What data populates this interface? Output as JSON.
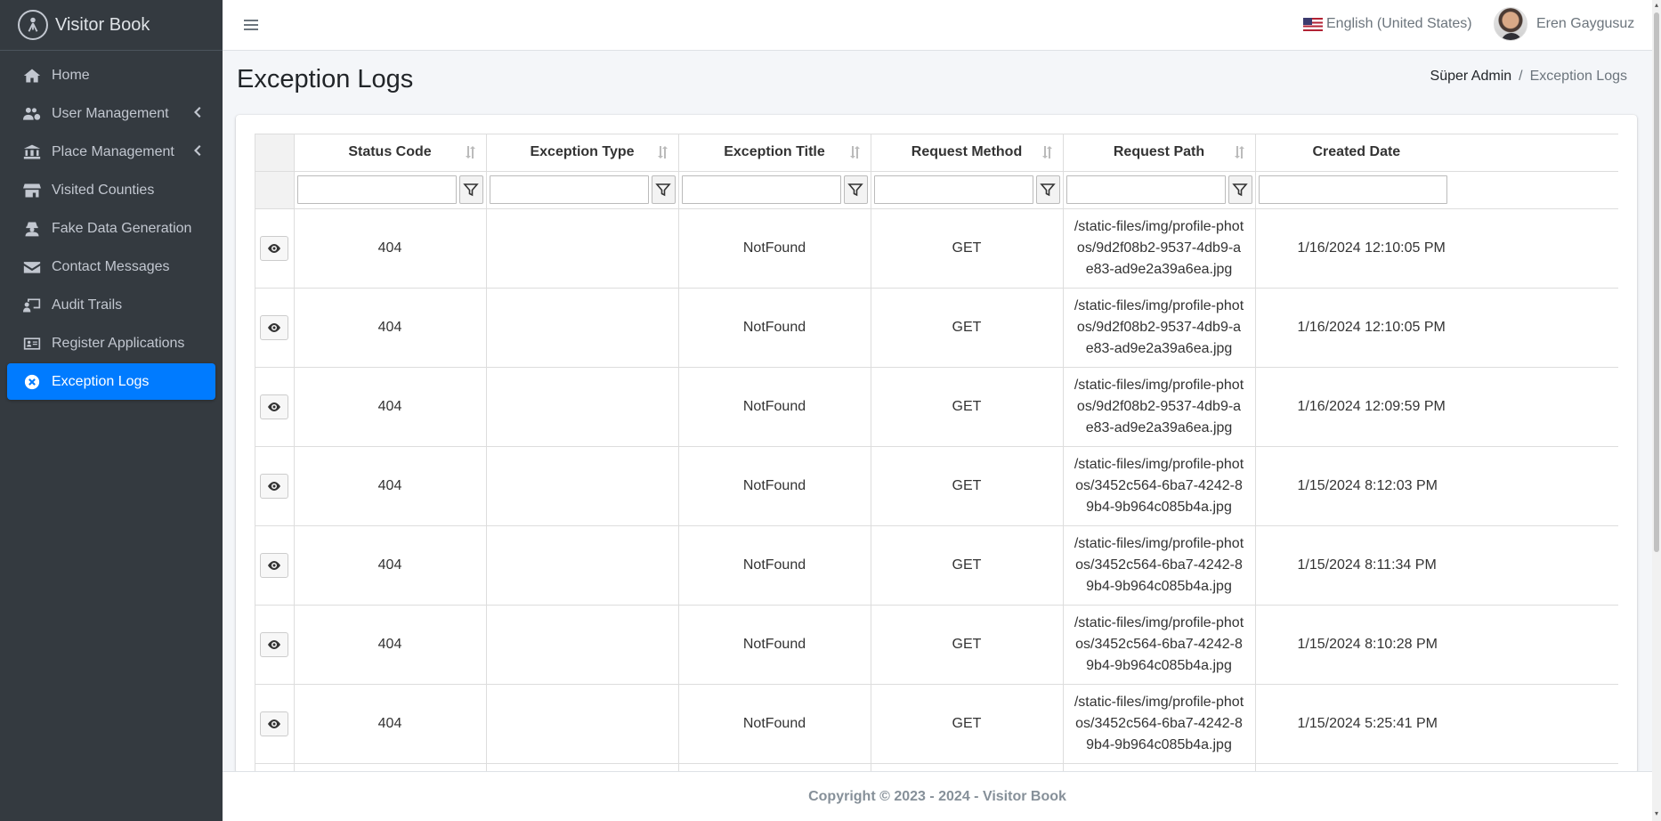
{
  "brand": {
    "name": "Visitor Book"
  },
  "sidebar": {
    "items": [
      {
        "label": "Home",
        "icon": "home-icon"
      },
      {
        "label": "User Management",
        "icon": "users-cog-icon",
        "has_children": true
      },
      {
        "label": "Place Management",
        "icon": "landmark-icon",
        "has_children": true
      },
      {
        "label": "Visited Counties",
        "icon": "store-icon"
      },
      {
        "label": "Fake Data Generation",
        "icon": "user-secret-icon"
      },
      {
        "label": "Contact Messages",
        "icon": "envelope-icon"
      },
      {
        "label": "Audit Trails",
        "icon": "chalkboard-user-icon"
      },
      {
        "label": "Register Applications",
        "icon": "id-card-icon"
      },
      {
        "label": "Exception Logs",
        "icon": "times-circle-icon",
        "active": true
      }
    ]
  },
  "topbar": {
    "language": "English (United States)",
    "user_name": "Eren Gaygusuz"
  },
  "page": {
    "title": "Exception Logs",
    "breadcrumb": [
      "Süper Admin",
      "Exception Logs"
    ]
  },
  "table": {
    "columns": [
      "Status Code",
      "Exception Type",
      "Exception Title",
      "Request Method",
      "Request Path",
      "Created Date"
    ],
    "rows": [
      {
        "status": "404",
        "type": "",
        "title": "NotFound",
        "method": "GET",
        "path": "/static-files/img/profile-photos/9d2f08b2-9537-4db9-ae83-ad9e2a39a6ea.jpg",
        "date": "1/16/2024 12:10:05 PM"
      },
      {
        "status": "404",
        "type": "",
        "title": "NotFound",
        "method": "GET",
        "path": "/static-files/img/profile-photos/9d2f08b2-9537-4db9-ae83-ad9e2a39a6ea.jpg",
        "date": "1/16/2024 12:10:05 PM"
      },
      {
        "status": "404",
        "type": "",
        "title": "NotFound",
        "method": "GET",
        "path": "/static-files/img/profile-photos/9d2f08b2-9537-4db9-ae83-ad9e2a39a6ea.jpg",
        "date": "1/16/2024 12:09:59 PM"
      },
      {
        "status": "404",
        "type": "",
        "title": "NotFound",
        "method": "GET",
        "path": "/static-files/img/profile-photos/3452c564-6ba7-4242-89b4-9b964c085b4a.jpg",
        "date": "1/15/2024 8:12:03 PM"
      },
      {
        "status": "404",
        "type": "",
        "title": "NotFound",
        "method": "GET",
        "path": "/static-files/img/profile-photos/3452c564-6ba7-4242-89b4-9b964c085b4a.jpg",
        "date": "1/15/2024 8:11:34 PM"
      },
      {
        "status": "404",
        "type": "",
        "title": "NotFound",
        "method": "GET",
        "path": "/static-files/img/profile-photos/3452c564-6ba7-4242-89b4-9b964c085b4a.jpg",
        "date": "1/15/2024 8:10:28 PM"
      },
      {
        "status": "404",
        "type": "",
        "title": "NotFound",
        "method": "GET",
        "path": "/static-files/img/profile-photos/3452c564-6ba7-4242-89b4-9b964c085b4a.jpg",
        "date": "1/15/2024 5:25:41 PM"
      }
    ]
  },
  "footer": {
    "text": "Copyright © 2023 - 2024 - Visitor Book"
  },
  "colors": {
    "sidebar_bg": "#343a40",
    "active": "#007bff",
    "page_bg": "#f4f6f9"
  }
}
